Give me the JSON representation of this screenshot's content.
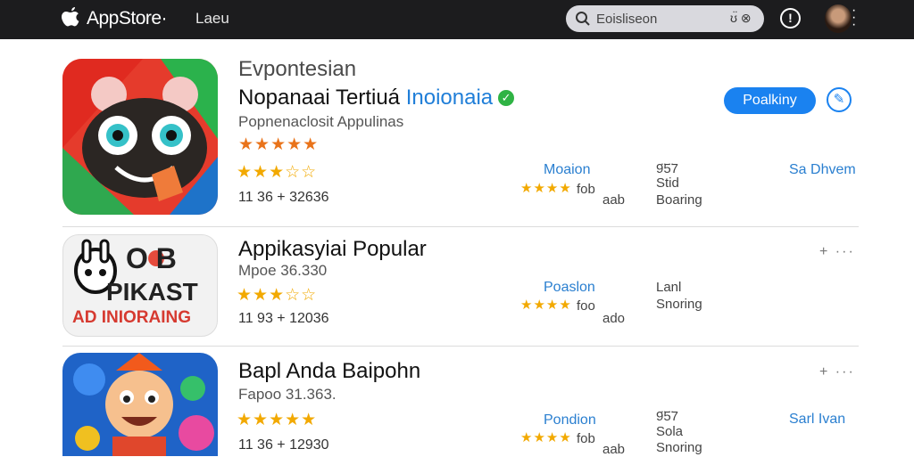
{
  "header": {
    "brand": "AppStore·",
    "nav_label": "Laeu",
    "search_value": "Eoisliseon",
    "search_mic": "ʊ̈ ⊗",
    "info_glyph": "!"
  },
  "featured": {
    "section_title": "Evpontesian",
    "app_name": "Nopanaai Tertiuá",
    "app_name_accent": "Inoionaia",
    "subtitle": "Popnenaclosit Appulinas",
    "rating_line1": "★★★★★",
    "rating_line2": "★★★☆☆",
    "stats": "11 36  + 32636",
    "install_label": "Poalkiny",
    "edit_glyph": "✎",
    "col1_title": "Moaion",
    "col1_stars": "★★★★",
    "col1_suffix": "fob",
    "col1_sub": "aab",
    "col2_num": "9̈5̈7",
    "col2_title": "Stid",
    "col2_sub": "Boaring",
    "col3_title": "Sa Dhvem"
  },
  "apps": [
    {
      "name": "Appikasyiai Popular",
      "subtitle": "Mpoe 36.330",
      "rating": "★★★☆☆",
      "stats": "11 93  + 12036",
      "col1_title": "Poaslon",
      "col1_stars": "★★★★",
      "col1_suffix": "foo",
      "col1_sub": "ado",
      "col2_title": "Lanl",
      "col2_sub": "Snoring",
      "more": "+ ···",
      "icon_text_1": "O B",
      "icon_text_2": "PIKAST",
      "icon_text_3": "AD INIORAING"
    },
    {
      "name": "Bapl Anda Baipohn",
      "subtitle": "Fapoo 31.363.",
      "rating": "★★★★★",
      "stats": "11 36  + 12930",
      "col1_title": "Pondion",
      "col1_stars": "★★★★",
      "col1_suffix": "fob",
      "col1_sub": "aab",
      "col2_num": "9̈5̈7",
      "col2_title": "Sola",
      "col2_sub": "Snoring",
      "col3_title": "Sarl Ivan",
      "more": "+ ···"
    }
  ],
  "colors": {
    "accent": "#1a82f0",
    "topbar": "#1c1c1e",
    "verified": "#2fb344",
    "star": "#f2a900"
  },
  "icons": [
    "apple-logo-icon",
    "search-icon",
    "mic-icon",
    "info-icon",
    "avatar",
    "verified-icon",
    "edit-icon",
    "more-icon"
  ]
}
